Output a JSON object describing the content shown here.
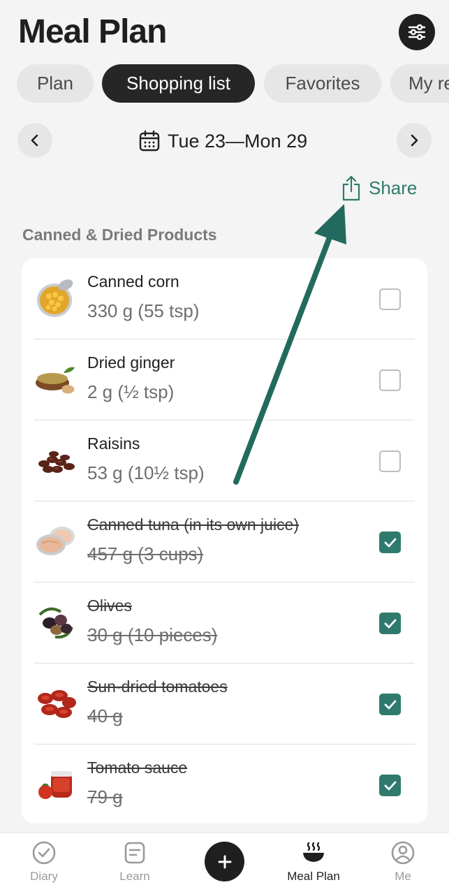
{
  "header": {
    "title": "Meal Plan"
  },
  "tabs": [
    {
      "label": "Plan",
      "active": false
    },
    {
      "label": "Shopping list",
      "active": true
    },
    {
      "label": "Favorites",
      "active": false
    },
    {
      "label": "My re",
      "active": false
    }
  ],
  "date_nav": {
    "range": "Tue 23—Mon 29"
  },
  "share": {
    "label": "Share"
  },
  "section": {
    "title": "Canned & Dried Products"
  },
  "items": [
    {
      "name": "Canned corn",
      "qty": "330 g (55 tsp)",
      "checked": false,
      "icon": "canned-corn-icon"
    },
    {
      "name": "Dried ginger",
      "qty": "2 g (½ tsp)",
      "checked": false,
      "icon": "dried-ginger-icon"
    },
    {
      "name": "Raisins",
      "qty": "53 g (10½ tsp)",
      "checked": false,
      "icon": "raisins-icon"
    },
    {
      "name": "Canned tuna (in its own juice)",
      "qty": "457 g (3 cups)",
      "checked": true,
      "icon": "canned-tuna-icon"
    },
    {
      "name": "Olives",
      "qty": "30 g (10 pieces)",
      "checked": true,
      "icon": "olives-icon"
    },
    {
      "name": "Sun-dried tomatoes",
      "qty": "40 g",
      "checked": true,
      "icon": "sun-dried-tomatoes-icon"
    },
    {
      "name": "Tomato sauce",
      "qty": "79 g",
      "checked": true,
      "icon": "tomato-sauce-icon"
    }
  ],
  "nav": {
    "diary": "Diary",
    "learn": "Learn",
    "meal_plan": "Meal Plan",
    "me": "Me"
  },
  "colors": {
    "accent": "#2f7a6c",
    "dark": "#1f1f1f",
    "background": "#f4f4f4"
  }
}
